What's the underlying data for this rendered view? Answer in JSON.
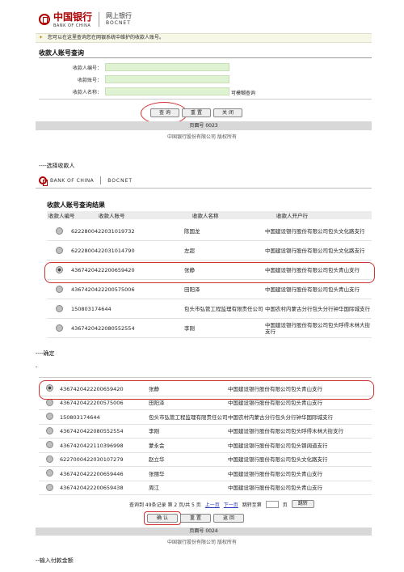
{
  "screen1": {
    "bank_name_cn": "中国银行",
    "bank_name_en": "BANK OF CHINA",
    "service_cn": "网上银行",
    "service_en": "BOCNET",
    "tip": "您可以在这里查询您在网银系统中维护的收款人账号。",
    "section_title": "收款人账号查询",
    "fields": [
      {
        "label": "收款人编号：",
        "value": ""
      },
      {
        "label": "收款账号：",
        "value": ""
      },
      {
        "label": "收款人名称：",
        "value": ""
      }
    ],
    "fuzzy_label": "可模糊查询",
    "buttons": {
      "query": "查 询",
      "reset": "重 置",
      "close": "关 闭"
    },
    "page_no": "页面号 0023",
    "copyright": "中国银行股份有限公司 版权所有"
  },
  "caption1": "----选择收款人",
  "screen2": {
    "bank_name_en": "BANK OF CHINA",
    "service_en": "BOCNET",
    "section_title": "收款人账号查询结果",
    "columns": [
      "收款人编号",
      "收款人账号",
      "收款人名称",
      "收款人开户行"
    ],
    "rows": [
      {
        "account": "6222800422031019732",
        "name": "陈国龙",
        "bank": "中国建设银行股份有限公司包头文化路支行",
        "selected": false
      },
      {
        "account": "6222800422031014790",
        "name": "左超",
        "bank": "中国建设银行股份有限公司包头文化路支行",
        "selected": false
      },
      {
        "account": "4367420422200659420",
        "name": "张静",
        "bank": "中国建设银行股份有限公司包头青山支行",
        "selected": true
      },
      {
        "account": "4367420422200575006",
        "name": "田阳泽",
        "bank": "中国建设银行股份有限公司包头青山支行",
        "selected": false
      },
      {
        "account": "150803174644",
        "name": "包头市弘管工程监理有限责任公司",
        "bank": "中国农村内蒙古分行包头分行钟华国际城支行",
        "selected": false
      },
      {
        "account": "4367420422080552554",
        "name": "李刚",
        "bank": "中国建设银行股份有限公司包头呼得木林大街支行",
        "selected": false
      }
    ]
  },
  "caption2": "----确定",
  "dash": "-",
  "screen3": {
    "rows": [
      {
        "account": "4367420422200659420",
        "name": "张静",
        "bank": "中国建设银行股份有限公司包头青山支行",
        "selected": true
      },
      {
        "account": "4367420422200575006",
        "name": "田阳泽",
        "bank": "中国建设银行股份有限公司包头青山支行",
        "selected": false
      },
      {
        "account": "150803174644",
        "name": "包头市弘管工程监理有限责任公司",
        "bank": "中国农村内蒙古分行包头分行钟华国际城支行",
        "selected": false
      },
      {
        "account": "4367420422080552554",
        "name": "李刚",
        "bank": "中国建设银行股份有限公司包头呼得木林大街支行",
        "selected": false
      },
      {
        "account": "4367420422110396998",
        "name": "蒙永会",
        "bank": "中国建设银行股份有限公司包头钢阔道支行",
        "selected": false
      },
      {
        "account": "6227000422030107279",
        "name": "赵立华",
        "bank": "中国建设银行股份有限公司包头文化路支行",
        "selected": false
      },
      {
        "account": "4367420422200659446",
        "name": "张丽华",
        "bank": "中国建设银行股份有限公司包头青山支行",
        "selected": false
      },
      {
        "account": "4367420422200659438",
        "name": "周江",
        "bank": "中国建设银行股份有限公司包头青山支行",
        "selected": false
      }
    ],
    "pagination": {
      "summary": "查询到 49条记录  第 2 页/共 5 页",
      "prev": "上一页",
      "next": "下一页",
      "jump_label": "跳转至第",
      "jump_value": "",
      "jump_unit": "页",
      "jump_button": "跳转"
    },
    "buttons": {
      "ok": "确 认",
      "reset": "重 置",
      "back": "返 回"
    },
    "page_no": "页面号 0024",
    "copyright": "中国银行股份有限公司 版权所有"
  },
  "caption3": "--输入付款金额",
  "colors": {
    "brand_red": "#b00000",
    "highlight_red": "#d43030",
    "input_green": "#dff2d2"
  }
}
